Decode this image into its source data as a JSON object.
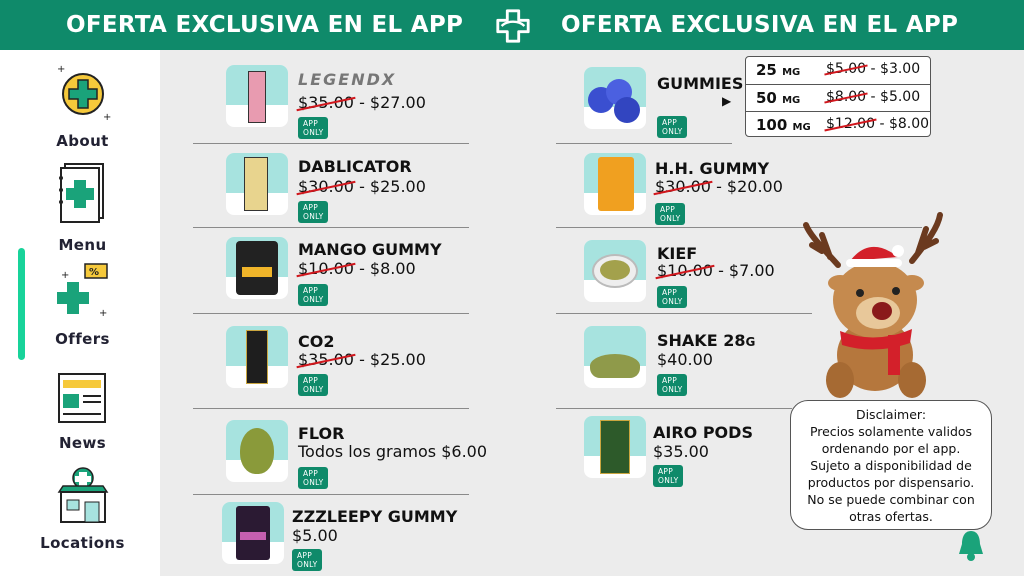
{
  "header": {
    "left_text": "OFERTA EXCLUSIVA EN EL APP",
    "right_text": "OFERTA EXCLUSIVA EN EL APP"
  },
  "colors": {
    "brand": "#0f8a6a",
    "accent": "#18d39a",
    "thumb_bg": "#a7e3df",
    "strike": "#d0161c"
  },
  "sidebar": {
    "items": [
      {
        "label": "About",
        "icon": "cannabis-cross-coin-icon"
      },
      {
        "label": "Menu",
        "icon": "menu-book-icon"
      },
      {
        "label": "Offers",
        "icon": "discount-tag-icon",
        "active": true
      },
      {
        "label": "News",
        "icon": "newspaper-icon"
      },
      {
        "label": "Locations",
        "icon": "storefront-icon"
      }
    ]
  },
  "badge": "APP ONLY",
  "left_products": [
    {
      "name": "LEGENDX",
      "old": "$35.00",
      "new": " - $27.00"
    },
    {
      "name": "DABLICATOR",
      "old": "$30.00",
      "new": " - $25.00"
    },
    {
      "name": "MANGO GUMMY",
      "old": "$10.00",
      "new": " - $8.00"
    },
    {
      "name": "CO2",
      "old": "$35.00",
      "new": " - $25.00"
    },
    {
      "name": "FLOR",
      "price": "Todos los gramos $6.00"
    },
    {
      "name": "ZZZLEEPY GUMMY",
      "price": "$5.00"
    }
  ],
  "right_products": [
    {
      "name": "GUMMIES"
    },
    {
      "name": "H.H. GUMMY",
      "old": "$30.00",
      "new": " - $20.00"
    },
    {
      "name": "KIEF",
      "old": "$10.00",
      "new": " - $7.00"
    },
    {
      "name": "SHAKE 28",
      "suffix": "G",
      "price": "$40.00"
    },
    {
      "name": "AIRO PODS",
      "price": "$35.00"
    }
  ],
  "gummies_table": [
    {
      "mg": "25",
      "unit": "MG",
      "old": "$5.00",
      "new": " - $3.00"
    },
    {
      "mg": "50",
      "unit": "MG",
      "old": "$8.00",
      "new": " - $5.00"
    },
    {
      "mg": "100",
      "unit": "MG",
      "old": "$12.00",
      "new": " - $8.00"
    }
  ],
  "disclaimer": {
    "lines": [
      "Disclaimer:",
      "Precios solamente validos",
      "ordenando por el app.",
      "Sujeto a disponibilidad de",
      "productos por dispensario.",
      "No se puede combinar con",
      "otras ofertas."
    ]
  }
}
